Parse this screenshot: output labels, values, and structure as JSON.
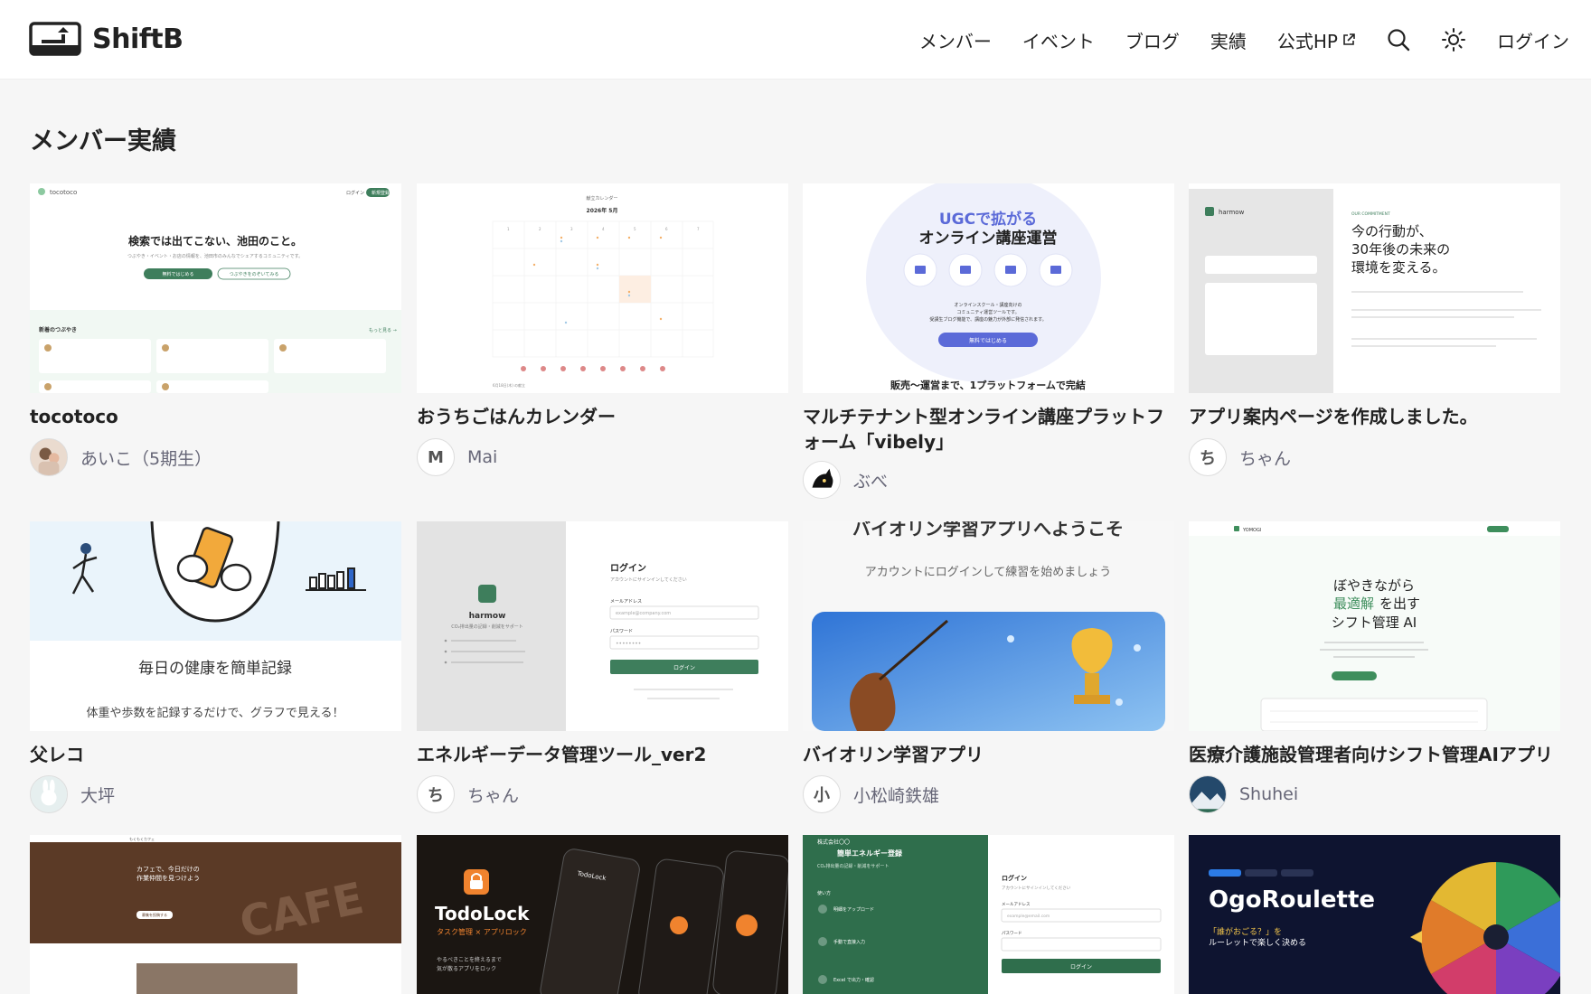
{
  "header": {
    "logo_text": "ShiftB",
    "nav": {
      "members": "メンバー",
      "events": "イベント",
      "blog": "ブログ",
      "results": "実績",
      "official": "公式HP"
    },
    "login": "ログイン"
  },
  "page_title": "メンバー実績",
  "cards": [
    {
      "title": "tocotoco",
      "author": "あいこ（5期生）",
      "avatar": "",
      "thumb": {
        "brand": "tocotoco",
        "login": "ログイン",
        "signup": "新規登録",
        "headline": "検索では出てこない、池田のこと。",
        "sub": "つぶやき・イベント・お店の情報を、池田市のみんなでシェアするコミュニティです。",
        "primary": "無料ではじめる",
        "secondary": "つぶやきをのぞいてみる",
        "section": "新着のつぶやき",
        "more": "もっと見る →"
      }
    },
    {
      "title": "おうちごはんカレンダー",
      "author": "Mai",
      "avatar": "M",
      "thumb": {
        "cap": "献立カレンダー",
        "month": "2026年 5月",
        "foot": "6月18日(木) の献立"
      }
    },
    {
      "title": "マルチテナント型オンライン講座プラットフォーム「vibely」",
      "author": "ぶべ",
      "avatar": "",
      "thumb": {
        "l1": "UGCで拡がる",
        "l2": "オンライン講座運営",
        "desc1": "オンラインスクール・講座向けの",
        "desc2": "コミュニティ運営ツールです。",
        "desc3": "受講生ブログ機能で、講座の魅力が外部に発信されます。",
        "cta": "無料ではじめる",
        "bottom": "販売〜運営まで、1プラットフォームで完結"
      }
    },
    {
      "title": "アプリ案内ページを作成しました。",
      "author": "ちゃん",
      "avatar": "ち",
      "thumb": {
        "brand": "harmow",
        "tag": "OUR COMMITMENT",
        "h1": "今の行動が、",
        "h2": "30年後の未来の",
        "h3": "環境を変える。"
      }
    },
    {
      "title": "父レコ",
      "author": "大坪",
      "avatar": "",
      "thumb": {
        "headline": "毎日の健康を簡単記録",
        "sub": "体重や歩数を記録するだけで、グラフで見える！"
      }
    },
    {
      "title": "エネルギーデータ管理ツール_ver2",
      "author": "ちゃん",
      "avatar": "ち",
      "thumb": {
        "brand": "harmow",
        "brand_sub": "CO₂排出量の記録・削減をサポート",
        "login_title": "ログイン",
        "login_sub": "アカウントにサインインしてください",
        "email_label": "メールアドレス",
        "email_ph": "example@company.com",
        "pw_label": "パスワード",
        "pw_ph": "••••••••",
        "btn": "ログイン"
      }
    },
    {
      "title": "バイオリン学習アプリ",
      "author": "小松崎鉄雄",
      "avatar": "小",
      "thumb": {
        "headline": "バイオリン学習アプリへようこそ",
        "sub": "アカウントにログインして練習を始めましょう"
      }
    },
    {
      "title": "医療介護施設管理者向けシフト管理AIアプリ",
      "author": "Shuhei",
      "avatar": "",
      "thumb": {
        "brand": "YOMOGI",
        "l1": "ぼやきながら",
        "l2a": "最適解",
        "l2b": "を出す",
        "l3": "シフト管理 AI"
      }
    },
    {
      "title": "",
      "author": "",
      "avatar": "",
      "thumb": {
        "brand": "もくもくカフェ",
        "h1": "カフェで、今日だけの",
        "h2": "作業仲間を見つけよう",
        "big": "CAFE",
        "btn": "募集を投稿する"
      }
    },
    {
      "title": "",
      "author": "",
      "avatar": "",
      "thumb": {
        "brand": "TodoLock",
        "sub": "タスク管理 × アプリロック",
        "desc1": "やるべきことを終えるまで",
        "desc2": "気が散るアプリをロック",
        "phone": "TodoLock"
      }
    },
    {
      "title": "",
      "author": "",
      "avatar": "",
      "thumb": {
        "company": "株式会社〇〇",
        "title": "簡単エネルギー登録",
        "sub": "CO₂排出量の記録・削減をサポート",
        "how": "使い方",
        "step1": "明細をアップロード",
        "step2": "手動で直接入力",
        "step3": "Excel で出力・確認",
        "login_title": "ログイン",
        "login_sub": "アカウントにサインインしてください",
        "email_label": "メールアドレス",
        "email_ph": "example@email.com",
        "pw_label": "パスワード",
        "btn": "ログイン"
      }
    },
    {
      "title": "",
      "author": "",
      "avatar": "",
      "thumb": {
        "brand": "OgoRoulette",
        "sub": "「誰がおごる？」を",
        "sub2": "ルーレットで楽しく決める"
      }
    }
  ]
}
